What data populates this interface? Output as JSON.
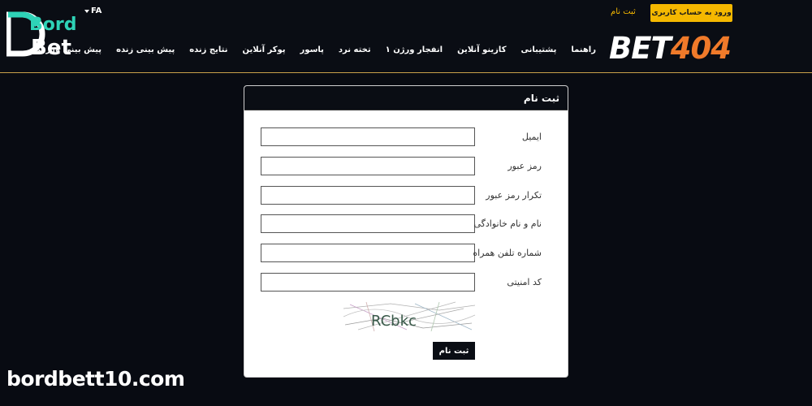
{
  "header": {
    "logo": {
      "line1": "Bord",
      "line2": "Bet"
    },
    "lang": "FA",
    "login_button": "ورود به حساب کاربری",
    "register_link": "ثبت نام",
    "brand": {
      "part1": "BET",
      "part2": "404"
    },
    "nav": [
      "پیش بینی ورزشی",
      "پیش بینی زنده",
      "نتایج زنده",
      "پوکر آنلاین",
      "پاسور",
      "تخته نرد",
      "انفجار ورژن ۱",
      "کازینو آنلاین",
      "پشتیبانی",
      "راهنما"
    ]
  },
  "form": {
    "title": "ثبت نام",
    "fields": [
      {
        "label": "ایمیل",
        "value": ""
      },
      {
        "label": "رمز عبور",
        "value": ""
      },
      {
        "label": "تکرار رمز عبور",
        "value": ""
      },
      {
        "label": "نام و نام خانوادگی",
        "value": ""
      },
      {
        "label": "شماره تلفن همراه",
        "value": ""
      },
      {
        "label": "کد امنیتی",
        "value": ""
      }
    ],
    "captcha_text": "RCbkc",
    "submit_label": "ثبت نام"
  },
  "watermark": "bordbett10.com",
  "colors": {
    "accent": "#f5b800",
    "brand_orange": "#f07a2a",
    "logo_teal": "#2ed3b7",
    "background": "#080b12"
  }
}
